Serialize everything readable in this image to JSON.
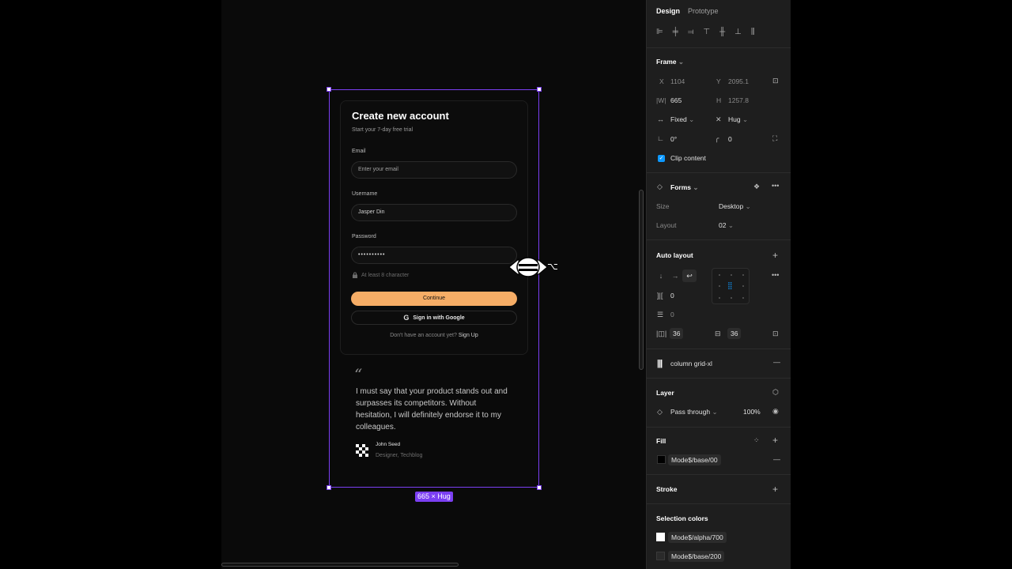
{
  "canvas": {
    "size_badge": "665 × Hug"
  },
  "form": {
    "title": "Create new account",
    "subtitle": "Start your 7-day free trial",
    "email_label": "Email",
    "email_placeholder": "Enter your email",
    "username_label": "Username",
    "username_value": "Jasper Din",
    "password_label": "Password",
    "password_value": "••••••••••",
    "password_hint": "At least 8 character",
    "continue_label": "Continue",
    "google_label": "Sign in with Google",
    "signup_prompt": "Don't have an account yet?",
    "signup_link": "Sign Up"
  },
  "testimonial": {
    "quote_mark": "“",
    "quote": "I must say that your product stands out and surpasses its competitors. Without hesitation, I will definitely endorse it to my colleagues.",
    "author_name": "John Seed",
    "author_role": "Designer, Techblog"
  },
  "panel": {
    "tabs": [
      "Design",
      "Prototype"
    ],
    "frame_title": "Frame",
    "x_label": "X",
    "x_value": "1104",
    "y_label": "Y",
    "y_value": "2095.1",
    "w_label": "|W|",
    "w_value": "665",
    "h_label": "H",
    "h_value": "1257.8",
    "width_mode": "Fixed",
    "height_mode": "Hug",
    "rotation": "0°",
    "radius": "0",
    "clip_content": "Clip content",
    "component_name": "Forms",
    "size_label": "Size",
    "size_value": "Desktop",
    "layout_label": "Layout",
    "layout_value": "02",
    "auto_layout_title": "Auto layout",
    "gap_value": "0",
    "gap2_value": "0",
    "pad_h": "36",
    "pad_v": "36",
    "grid_name": "column grid-xl",
    "layer_title": "Layer",
    "blend_mode": "Pass through",
    "opacity": "100%",
    "fill_title": "Fill",
    "fill_name": "Mode$/base/00",
    "stroke_title": "Stroke",
    "selection_colors_title": "Selection colors",
    "selection_colors": [
      "Mode$/alpha/700",
      "Mode$/base/200"
    ]
  },
  "colors": {
    "accent": "#f6ad66",
    "selection": "#7b3ff2",
    "figma_blue": "#0d99ff"
  }
}
